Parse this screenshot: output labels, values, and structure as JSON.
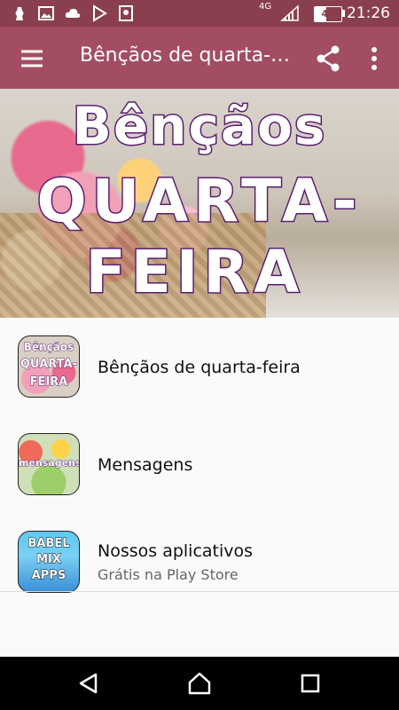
{
  "status_bar": {
    "network": "4G",
    "battery": "44 %",
    "battery_level": 0.44,
    "time": "21:26",
    "icons": [
      "notification-icon",
      "image-icon",
      "cloud-icon",
      "play-store-icon",
      "location-icon",
      "signal-icon"
    ]
  },
  "toolbar": {
    "title": "Bênçãos de quarta-feira",
    "menu_icon": "hamburger-menu-icon",
    "share_icon": "share-icon",
    "more_icon": "more-vert-icon",
    "bar_color": "#a34d62",
    "status_color": "#8a3f4f"
  },
  "banner": {
    "line1": "Bênçãos",
    "line2": "QUARTA-",
    "line3": "FEIRA"
  },
  "list": [
    {
      "label": "Bênçãos de quarta-feira",
      "thumb_lines": [
        "Bênçãos",
        "QUARTA-",
        "FEIRA"
      ]
    },
    {
      "label": "Mensagens",
      "thumb_lines": [
        "mensagens"
      ]
    },
    {
      "label": "Nossos aplicativos",
      "sublabel": "Grátis na Play Store",
      "thumb_lines": [
        "BABEL",
        "MIX",
        "APPS"
      ]
    }
  ],
  "nav_bar": {
    "back_icon": "back-icon",
    "home_icon": "home-icon",
    "recents_icon": "recents-icon"
  }
}
